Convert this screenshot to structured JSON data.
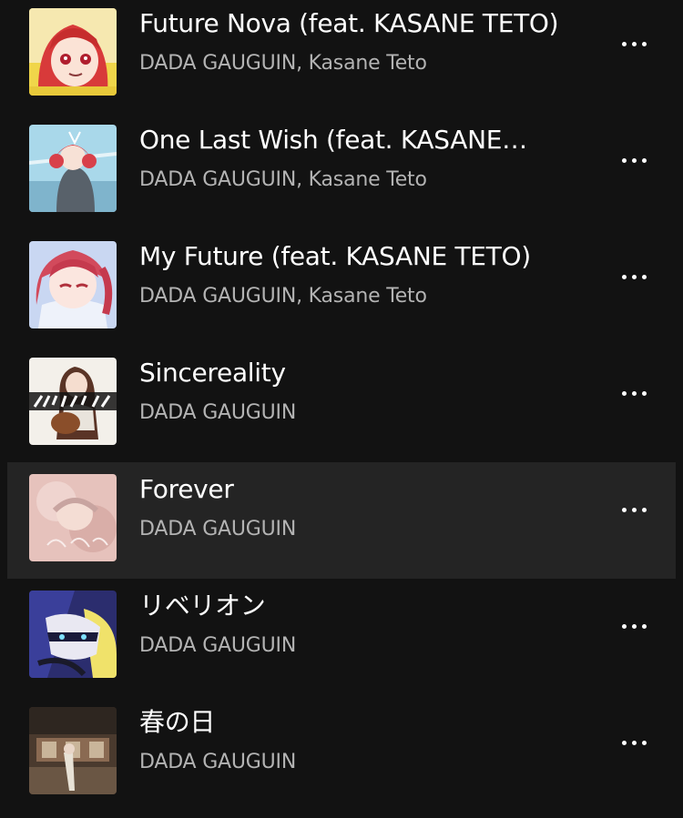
{
  "tracks": [
    {
      "title": "Future Nova (feat. KASANE TETO)",
      "artist": "DADA GAUGUIN, Kasane Teto",
      "cover": "cover-future-nova"
    },
    {
      "title": "One Last Wish (feat. KASANE…",
      "artist": "DADA GAUGUIN, Kasane Teto",
      "cover": "cover-one-last-wish"
    },
    {
      "title": "My Future (feat. KASANE TETO)",
      "artist": "DADA GAUGUIN, Kasane Teto",
      "cover": "cover-my-future"
    },
    {
      "title": "Sincereality",
      "artist": "DADA GAUGUIN",
      "cover": "cover-sincereality"
    },
    {
      "title": "Forever",
      "artist": "DADA GAUGUIN",
      "cover": "cover-forever",
      "highlighted": true
    },
    {
      "title": "リベリオン",
      "artist": "DADA GAUGUIN",
      "cover": "cover-rebellion"
    },
    {
      "title": "春の日",
      "artist": "DADA GAUGUIN",
      "cover": "cover-haru-no-hi"
    }
  ],
  "icons": {
    "more": "more-options-icon"
  },
  "colors": {
    "background": "#121212",
    "highlight": "#242424",
    "title": "#ffffff",
    "artist": "#b3b3b3"
  }
}
